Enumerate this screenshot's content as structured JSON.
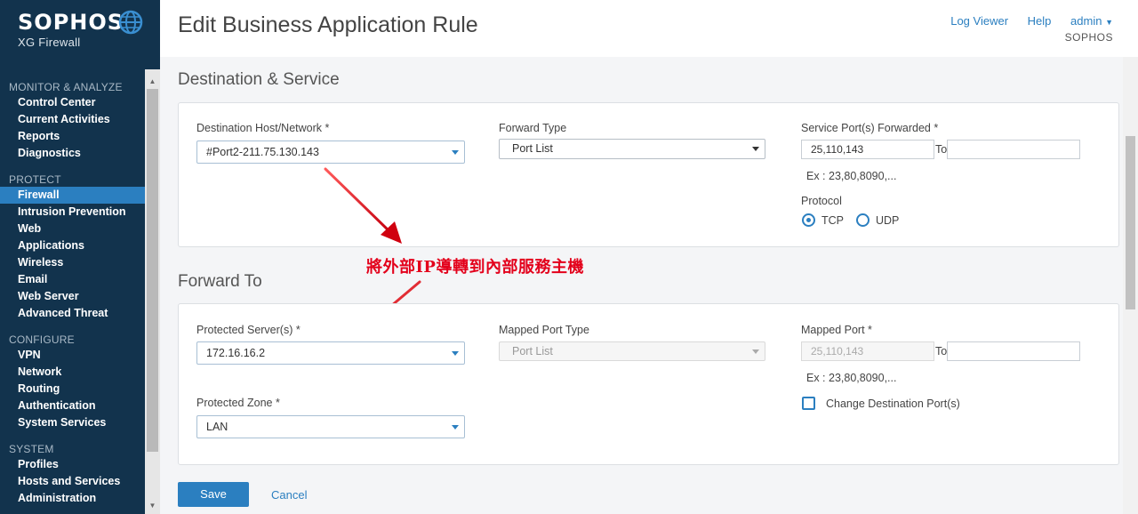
{
  "brand": {
    "logo_text": "SOPHOS",
    "product": "XG Firewall"
  },
  "sidebar": {
    "sections": [
      {
        "title": "MONITOR & ANALYZE",
        "items": [
          "Control Center",
          "Current Activities",
          "Reports",
          "Diagnostics"
        ]
      },
      {
        "title": "PROTECT",
        "items": [
          "Firewall",
          "Intrusion Prevention",
          "Web",
          "Applications",
          "Wireless",
          "Email",
          "Web Server",
          "Advanced Threat"
        ]
      },
      {
        "title": "CONFIGURE",
        "items": [
          "VPN",
          "Network",
          "Routing",
          "Authentication",
          "System Services"
        ]
      },
      {
        "title": "SYSTEM",
        "items": [
          "Profiles",
          "Hosts and Services",
          "Administration"
        ]
      }
    ],
    "active_item": "Firewall"
  },
  "header": {
    "title": "Edit Business Application Rule",
    "links": {
      "log_viewer": "Log Viewer",
      "help": "Help",
      "user": "admin"
    },
    "org": "SOPHOS"
  },
  "destination_service": {
    "section_title": "Destination & Service",
    "dest_host_label": "Destination Host/Network *",
    "dest_host_value": "#Port2-211.75.130.143",
    "forward_type_label": "Forward Type",
    "forward_type_value": "Port List",
    "service_port_label": "Service Port(s) Forwarded *",
    "service_port_value": "25,110,143",
    "service_port_to_label": "To",
    "service_port_to_value": "",
    "example_hint": "Ex : 23,80,8090,...",
    "protocol_label": "Protocol",
    "protocol_options": [
      "TCP",
      "UDP"
    ],
    "protocol_selected": "TCP"
  },
  "annotation": {
    "text": "將外部IP導轉到內部服務主機"
  },
  "forward_to": {
    "section_title": "Forward To",
    "protected_server_label": "Protected Server(s) *",
    "protected_server_value": "172.16.16.2",
    "mapped_port_type_label": "Mapped Port Type",
    "mapped_port_type_value": "Port List",
    "mapped_port_label": "Mapped Port *",
    "mapped_port_value": "25,110,143",
    "mapped_port_to_label": "To",
    "mapped_port_to_value": "",
    "example_hint": "Ex : 23,80,8090,...",
    "protected_zone_label": "Protected Zone *",
    "protected_zone_value": "LAN",
    "change_dest_port_label": "Change Destination Port(s)",
    "change_dest_port_checked": false
  },
  "footer": {
    "save_label": "Save",
    "cancel_label": "Cancel"
  },
  "colors": {
    "sidebar_bg": "#12334d",
    "accent": "#2b7fc0",
    "annotation": "#e3001b"
  }
}
